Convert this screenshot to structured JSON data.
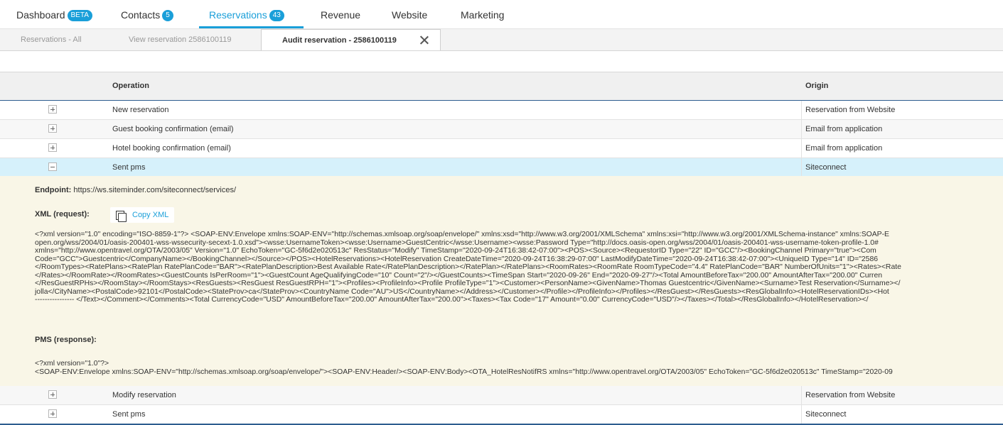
{
  "nav": {
    "items": [
      {
        "label": "Dashboard",
        "badge": "BETA"
      },
      {
        "label": "Contacts",
        "badge": "5"
      },
      {
        "label": "Reservations",
        "badge": "43"
      },
      {
        "label": "Revenue"
      },
      {
        "label": "Website"
      },
      {
        "label": "Marketing"
      }
    ],
    "active": "Reservations"
  },
  "subtabs": [
    {
      "label": "Reservations - All"
    },
    {
      "label": "View reservation 2586100119"
    },
    {
      "label": "Audit reservation - 2586100119"
    }
  ],
  "table": {
    "headers": {
      "operation": "Operation",
      "origin": "Origin"
    },
    "rows_top": [
      {
        "operation": "New reservation",
        "origin": "Reservation from Website"
      },
      {
        "operation": "Guest booking confirmation (email)",
        "origin": "Email from application"
      },
      {
        "operation": "Hotel booking confirmation (email)",
        "origin": "Email from application"
      },
      {
        "operation": "Sent pms",
        "origin": "Siteconnect"
      }
    ],
    "rows_bottom": [
      {
        "operation": "Modify reservation",
        "origin": "Reservation from Website"
      },
      {
        "operation": "Sent pms",
        "origin": "Siteconnect"
      }
    ]
  },
  "detail": {
    "endpoint_label": "Endpoint:",
    "endpoint_value": "https://ws.siteminder.com/siteconnect/services/",
    "xml_request_label": "XML (request):",
    "copy_xml": "Copy XML",
    "xml_request_lines": [
      "<?xml version=\"1.0\" encoding=\"ISO-8859-1\"?> <SOAP-ENV:Envelope xmlns:SOAP-ENV=\"http://schemas.xmlsoap.org/soap/envelope/\" xmlns:xsd=\"http://www.w3.org/2001/XMLSchema\" xmlns:xsi=\"http://www.w3.org/2001/XMLSchema-instance\" xmlns:SOAP-E",
      "open.org/wss/2004/01/oasis-200401-wss-wssecurity-secext-1.0.xsd\"><wsse:UsernameToken><wsse:Username>GuestCentric</wsse:Username><wsse:Password Type=\"http://docs.oasis-open.org/wss/2004/01/oasis-200401-wss-username-token-profile-1.0#",
      "xmlns=\"http://www.opentravel.org/OTA/2003/05\" Version=\"1.0\" EchoToken=\"GC-5f6d2e020513c\" ResStatus=\"Modify\" TimeStamp=\"2020-09-24T16:38:42-07:00\"><POS><Source><RequestorID Type=\"22\" ID=\"GCC\"/><BookingChannel Primary=\"true\"><Com",
      "Code=\"GCC\">Guestcentric</CompanyName></BookingChannel></Source></POS><HotelReservations><HotelReservation CreateDateTime=\"2020-09-24T16:38:29-07:00\" LastModifyDateTime=\"2020-09-24T16:38:42-07:00\"><UniqueID Type=\"14\" ID=\"2586",
      "</RoomTypes><RatePlans><RatePlan RatePlanCode=\"BAR\"><RatePlanDescription>Best Available Rate</RatePlanDescription></RatePlan></RatePlans><RoomRates><RoomRate RoomTypeCode=\"4.4\" RatePlanCode=\"BAR\" NumberOfUnits=\"1\"><Rates><Rate",
      "</Rates></RoomRate></RoomRates><GuestCounts IsPerRoom=\"1\"><GuestCount AgeQualifyingCode=\"10\" Count=\"2\"/></GuestCounts><TimeSpan Start=\"2020-09-26\" End=\"2020-09-27\"/><Total AmountBeforeTax=\"200.00\" AmountAfterTax=\"200.00\" Curren",
      "</ResGuestRPHs></RoomStay></RoomStays><ResGuests><ResGuest ResGuestRPH=\"1\"><Profiles><ProfileInfo><Profile ProfileType=\"1\"><Customer><PersonName><GivenName>Thomas Guestcentric</GivenName><Surname>Test Reservation</Surname></",
      "jolla</CityName><PostalCode>92101</PostalCode><StateProv>ca</StateProv><CountryName Code=\"AU\">US</CountryName></Address></Customer></Profile></ProfileInfo></Profiles></ResGuest></ResGuests><ResGlobalInfo><HotelReservationIDs><Hot",
      "---------------- </Text></Comment></Comments><Total CurrencyCode=\"USD\" AmountBeforeTax=\"200.00\" AmountAfterTax=\"200.00\"><Taxes><Tax Code=\"17\" Amount=\"0.00\" CurrencyCode=\"USD\"/></Taxes></Total></ResGlobalInfo></HotelReservation></"
    ],
    "pms_response_label": "PMS (response):",
    "pms_response_lines": [
      "<?xml version=\"1.0\"?>",
      "<SOAP-ENV:Envelope xmlns:SOAP-ENV=\"http://schemas.xmlsoap.org/soap/envelope/\"><SOAP-ENV:Header/><SOAP-ENV:Body><OTA_HotelResNotifRS xmlns=\"http://www.opentravel.org/OTA/2003/05\" EchoToken=\"GC-5f6d2e020513c\" TimeStamp=\"2020-09"
    ]
  }
}
